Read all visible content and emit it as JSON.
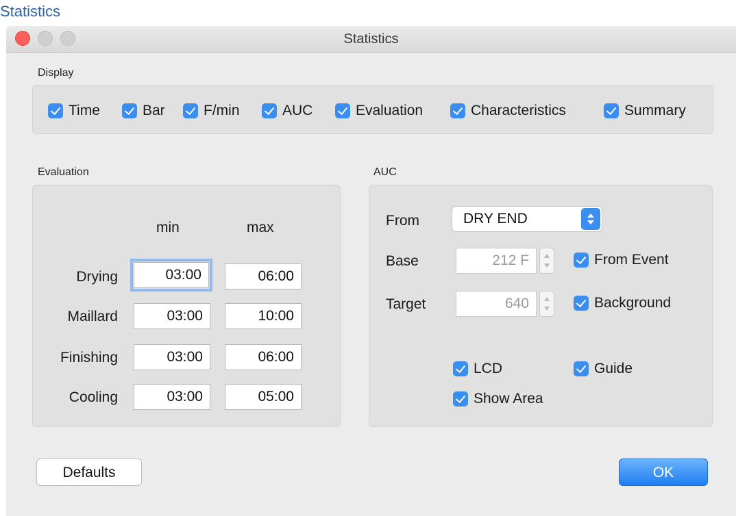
{
  "page_caption": "Statistics",
  "window": {
    "title": "Statistics"
  },
  "display": {
    "label": "Display",
    "items": [
      {
        "label": "Time",
        "checked": true
      },
      {
        "label": "Bar",
        "checked": true
      },
      {
        "label": "F/min",
        "checked": true
      },
      {
        "label": "AUC",
        "checked": true
      },
      {
        "label": "Evaluation",
        "checked": true
      },
      {
        "label": "Characteristics",
        "checked": true
      },
      {
        "label": "Summary",
        "checked": true
      }
    ]
  },
  "evaluation": {
    "label": "Evaluation",
    "col_min": "min",
    "col_max": "max",
    "rows": [
      {
        "label": "Drying",
        "min": "03:00",
        "max": "06:00"
      },
      {
        "label": "Maillard",
        "min": "03:00",
        "max": "10:00"
      },
      {
        "label": "Finishing",
        "min": "03:00",
        "max": "06:00"
      },
      {
        "label": "Cooling",
        "min": "03:00",
        "max": "05:00"
      }
    ]
  },
  "auc": {
    "label": "AUC",
    "from_label": "From",
    "from_value": "DRY END",
    "base_label": "Base",
    "base_value": "212 F",
    "target_label": "Target",
    "target_value": "640",
    "from_event": "From Event",
    "background": "Background",
    "lcd": "LCD",
    "guide": "Guide",
    "show_area": "Show Area"
  },
  "buttons": {
    "defaults": "Defaults",
    "ok": "OK"
  },
  "colors": {
    "accent": "#3a8ef0",
    "close": "#fc605c"
  }
}
